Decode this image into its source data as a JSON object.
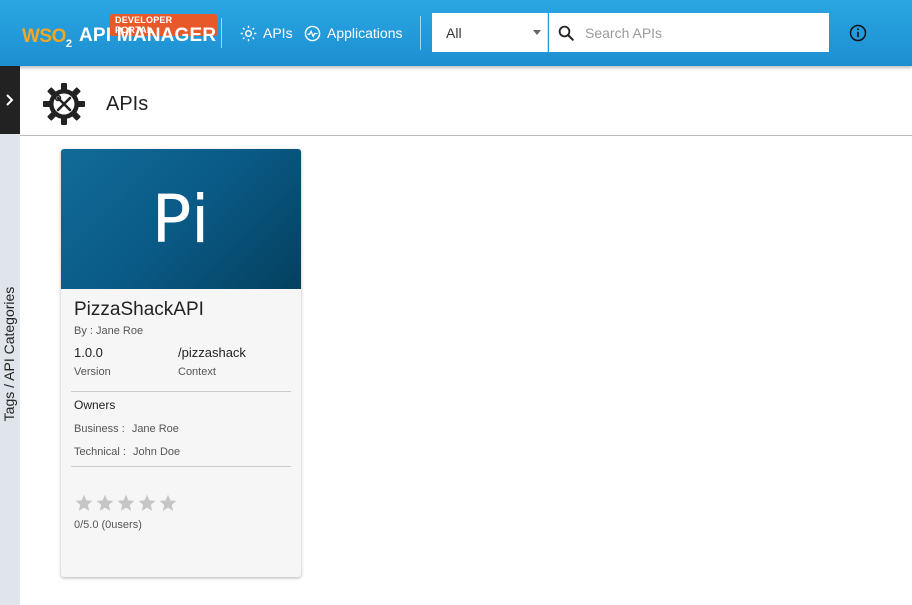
{
  "header": {
    "badge": "DEVELOPER PORTAL",
    "brand": "WSO",
    "brand_sub": "2",
    "product": "API MANAGER",
    "nav": {
      "apis": "APIs",
      "applications": "Applications"
    },
    "search_scope": "All",
    "search_placeholder": "Search APIs"
  },
  "sidebar": {
    "label": "Tags / API Categories"
  },
  "page": {
    "title": "APIs"
  },
  "api_card": {
    "thumb_text": "Pi",
    "name": "PizzaShackAPI",
    "by": "By : Jane Roe",
    "version_value": "1.0.0",
    "version_label": "Version",
    "context_value": "/pizzashack",
    "context_label": "Context",
    "owners_title": "Owners",
    "business_label": "Business :",
    "business_value": "Jane Roe",
    "technical_label": "Technical :",
    "technical_value": "John Doe",
    "rating_text": "0/5.0 (0users)"
  },
  "colors": {
    "header": "#1d8fd1",
    "badge": "#e8592a",
    "thumb": "#0a5a86",
    "star_empty": "#c6c6c6"
  }
}
